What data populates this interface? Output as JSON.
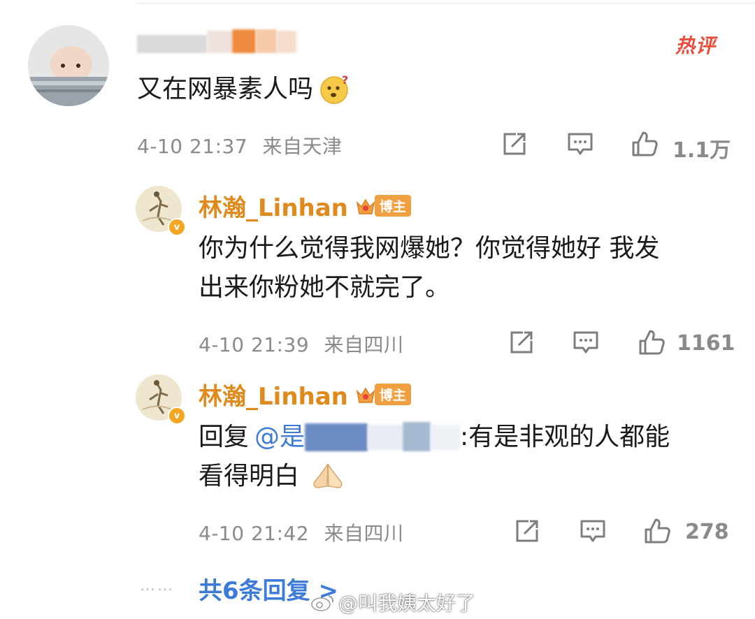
{
  "hot_tag": "热评",
  "comments": [
    {
      "text": "又在网暴素人吗",
      "time": "4-10 21:37",
      "location": "来自天津",
      "likes": "1.1万"
    }
  ],
  "replies": [
    {
      "username": "林瀚_Linhan",
      "badge": "博主",
      "text_line1": "你为什么觉得我网爆她？你觉得她好 我发",
      "text_line2": "出来你粉她不就完了。",
      "time": "4-10 21:39",
      "location": "来自四川",
      "likes": "1161"
    },
    {
      "username": "林瀚_Linhan",
      "badge": "博主",
      "reply_prefix": "回复",
      "mention": "@是",
      "text_after": ":有是非观的人都能",
      "text_line2": "看得明白",
      "time": "4-10 21:42",
      "location": "来自四川",
      "likes": "278"
    }
  ],
  "more_replies": "共6条回复 >",
  "dots": "……",
  "watermark": "@叫我姨太好了",
  "icons": {
    "share": "share-icon",
    "comment": "comment-icon",
    "like": "thumbs-up-icon",
    "emoji_1": "thinking-face-emoji",
    "emoji_2": "folded-hands-emoji",
    "weibo_logo": "weibo-logo"
  },
  "colors": {
    "username": "#e08a1e",
    "mention": "#3d7bd9",
    "hot": "#e94e3c",
    "meta": "#8a8a8a"
  }
}
